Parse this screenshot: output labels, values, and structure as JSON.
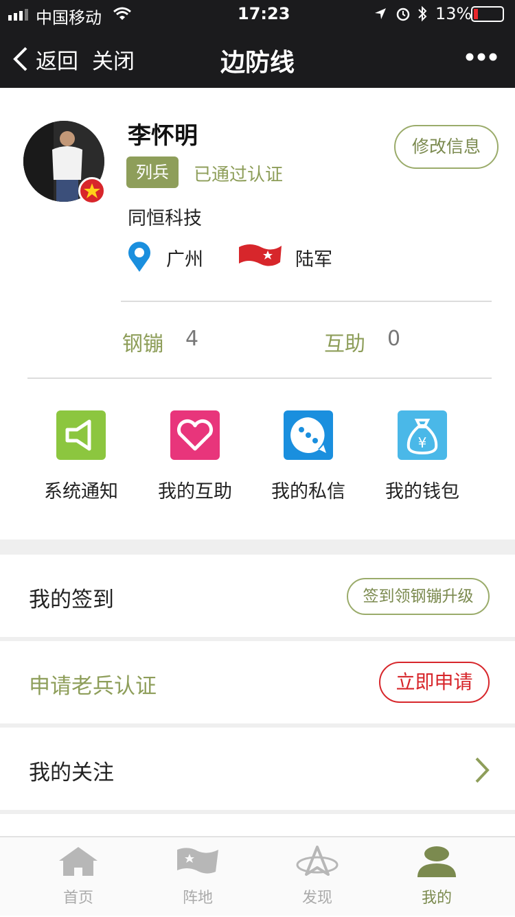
{
  "status_bar": {
    "carrier": "中国移动",
    "time": "17:23",
    "battery": "13%"
  },
  "nav": {
    "back_label": "返回",
    "close_label": "关闭",
    "title": "边防线"
  },
  "profile": {
    "name": "李怀明",
    "rank": "列兵",
    "verified_text": "已通过认证",
    "edit_label": "修改信息",
    "company": "同恒科技",
    "location": "广州",
    "branch": "陆军"
  },
  "stats": [
    {
      "label": "钢镚",
      "value": "4"
    },
    {
      "label": "互助",
      "value": "0"
    }
  ],
  "shortcuts": [
    {
      "label": "系统通知",
      "icon": "speaker-icon",
      "color": "#8cc63f"
    },
    {
      "label": "我的互助",
      "icon": "heart-icon",
      "color": "#e8357b"
    },
    {
      "label": "我的私信",
      "icon": "chat-icon",
      "color": "#1a8fde"
    },
    {
      "label": "我的钱包",
      "icon": "money-bag-icon",
      "color": "#4ab8e8"
    }
  ],
  "rows": {
    "checkin": {
      "label": "我的签到",
      "action": "签到领钢镚升级"
    },
    "veteran": {
      "label": "申请老兵认证",
      "action": "立即申请"
    },
    "follow": {
      "label": "我的关注"
    }
  },
  "tabs": [
    {
      "label": "首页",
      "icon": "home-icon"
    },
    {
      "label": "阵地",
      "icon": "flag-icon"
    },
    {
      "label": "发现",
      "icon": "compass-icon"
    },
    {
      "label": "我的",
      "icon": "user-icon",
      "active": true
    }
  ],
  "colors": {
    "accent": "#8e9e5a",
    "danger": "#d7262b",
    "nav_bg": "#1b1b1d"
  }
}
